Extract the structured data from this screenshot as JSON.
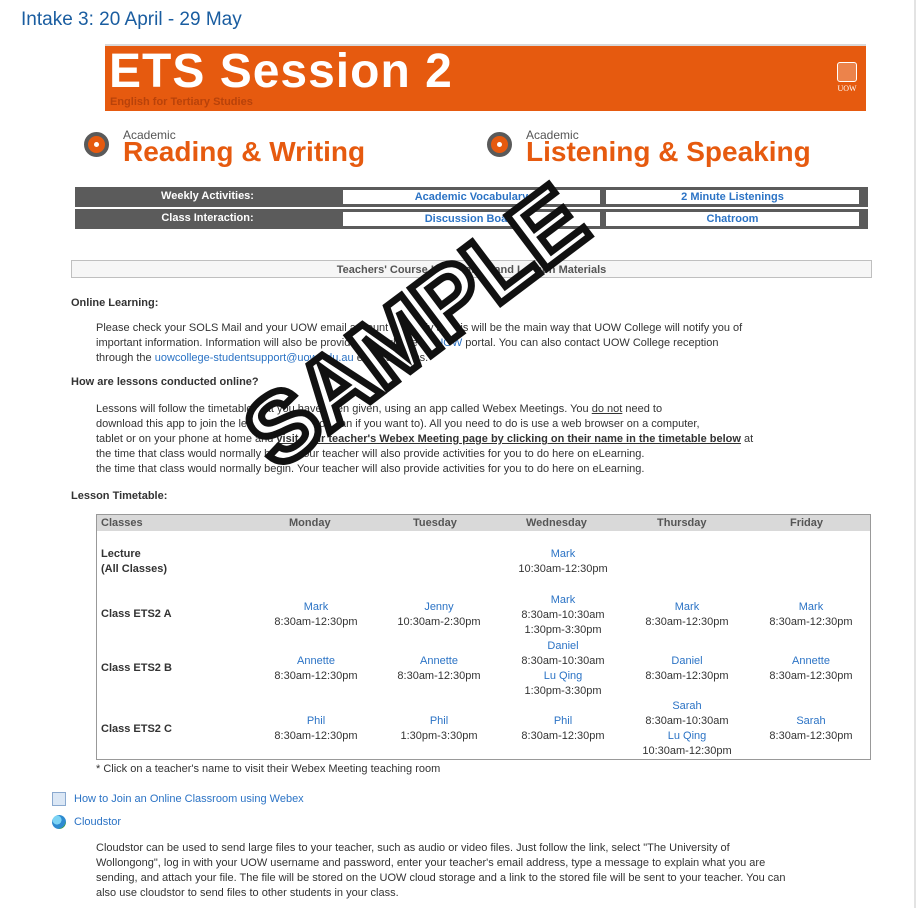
{
  "intake": "Intake 3: 20 April - 29 May",
  "banner": {
    "title": "ETS Session 2",
    "subtitle": "English for Tertiary Studies",
    "logo": "UOW"
  },
  "skills": [
    {
      "small": "Academic",
      "big": "Reading & Writing"
    },
    {
      "small": "Academic",
      "big": "Listening & Speaking"
    }
  ],
  "nav": [
    {
      "label": "Weekly Activities:",
      "link1": "Academic Vocabulary",
      "link2": "2 Minute Listenings"
    },
    {
      "label": "Class Interaction:",
      "link1": "Discussion Board",
      "link2": "Chatroom"
    }
  ],
  "info_bar": "Teachers' Course Information and Lesson Materials",
  "online": {
    "heading": "Online Learning:",
    "line1": "Please check your SOLS Mail and your UOW email account regularly as this will be the main way that UOW College will notify you of",
    "line2_a": "important information. Information will also be provided though the ",
    "line2_link": "MyUOW",
    "line2_b": " portal. You can also contact UOW College reception",
    "line3_a": "through the ",
    "line3_link": "uowcollege-studentsupport@uow.edu.au",
    "line3_b": " email address."
  },
  "lessons": {
    "heading": "How are lessons conducted online?",
    "line1_a": "Lessons will follow the timetable that you have been given, using an app called Webex Meetings. You ",
    "line1_u": "do not",
    "line1_b": " need to",
    "line2": "download this app to join the lesson (though you can if you want to). All you need to do is use a web browser on a computer,",
    "line3_a": "tablet or on your phone at home and ",
    "line3_u": "visit your teacher's Webex Meeting page by clicking on their name in the timetable below",
    "line3_b": " at",
    "line4": "the time that class would normally begin. Your teacher will also provide activities for you to do here on eLearning.",
    "line5": "the time that class would normally begin. Your teacher will also provide activities for you to do here on eLearning."
  },
  "timetable": {
    "heading": "Lesson Timetable:",
    "headers": [
      "Classes",
      "Monday",
      "Tuesday",
      "Wednesday",
      "Thursday",
      "Friday"
    ],
    "rows": [
      {
        "label1": "Lecture",
        "label2": "(All Classes)",
        "wed_teacher": "Mark",
        "wed_time": "10:30am-12:30pm"
      },
      {
        "label1": "Class ETS2 A",
        "mon_t": "Mark",
        "mon": "8:30am-12:30pm",
        "tue_t": "Jenny",
        "tue": "10:30am-2:30pm",
        "wed_t": "Mark",
        "wed1": "8:30am-10:30am",
        "wed2": "1:30pm-3:30pm",
        "thu_t": "Mark",
        "thu": "8:30am-12:30pm",
        "fri_t": "Mark",
        "fri": "8:30am-12:30pm"
      },
      {
        "label1": "Class ETS2 B",
        "mon_t": "Annette",
        "mon": "8:30am-12:30pm",
        "tue_t": "Annette",
        "tue": "8:30am-12:30pm",
        "wed_t": "Daniel",
        "wed1": "8:30am-10:30am",
        "wed_t2": "Lu Qing",
        "wed2": "1:30pm-3:30pm",
        "thu_t": "Daniel",
        "thu": "8:30am-12:30pm",
        "fri_t": "Annette",
        "fri": "8:30am-12:30pm"
      },
      {
        "label1": "Class ETS2 C",
        "mon_t": "Phil",
        "mon": "8:30am-12:30pm",
        "tue_t": "Phil",
        "tue": "1:30pm-3:30pm",
        "wed_t": "Phil",
        "wed": "8:30am-12:30pm",
        "thu_t": "Sarah",
        "thu1": "8:30am-10:30am",
        "thu_t2": "Lu Qing",
        "thu2": "10:30am-12:30pm",
        "fri_t": "Sarah",
        "fri": "8:30am-12:30pm"
      }
    ],
    "note": "* Click on a teacher's name to visit their Webex Meeting teaching room"
  },
  "resources": [
    {
      "label": "How to Join an Online Classroom using Webex",
      "icon": "document-icon"
    },
    {
      "label": "Cloudstor",
      "icon": "globe-icon"
    }
  ],
  "cloudstor_text": [
    "Cloudstor can be used to send large files to your teacher, such as audio or video files. Just follow the link, select \"The University of",
    "Wollongong\", log in with your UOW username and password, enter your teacher's email address, type a message to explain what you are",
    "sending, and attach your file. The file will be stored on the UOW cloud storage and a link to the stored file will be sent to your teacher. You can",
    "also use cloudstor to send files to other students in your class."
  ],
  "watermark": "SAMPLE",
  "colors": {
    "orange": "#e65a0f",
    "link": "#2b73c5",
    "dark": "#5b5b5b"
  }
}
